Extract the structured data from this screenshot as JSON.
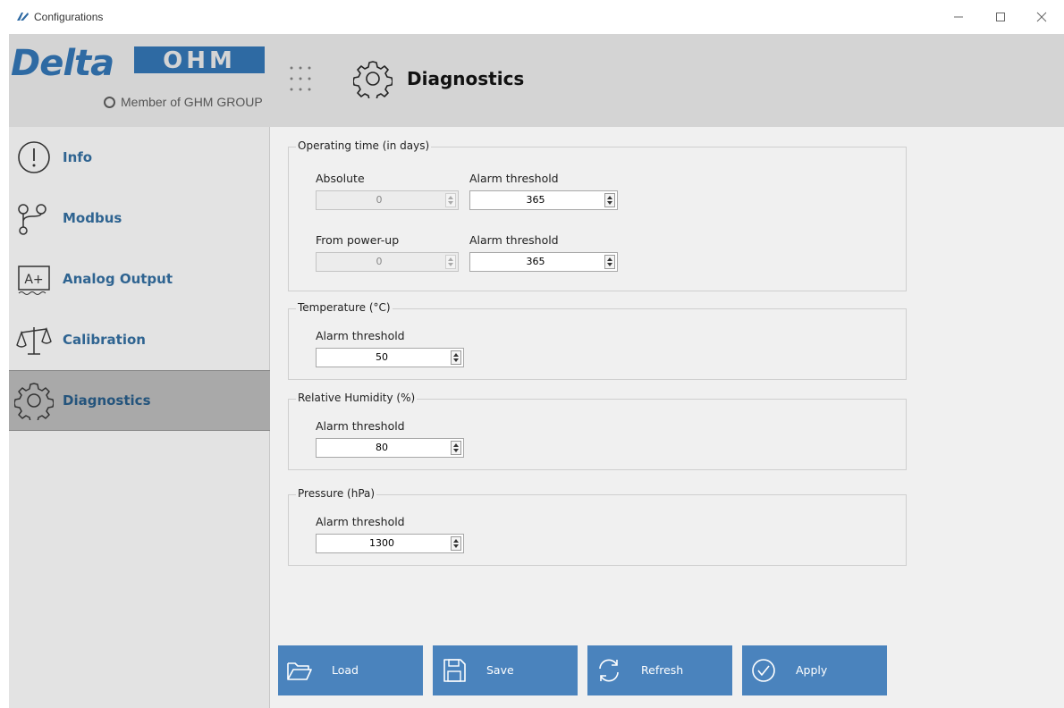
{
  "window": {
    "title": "Configurations"
  },
  "logo": {
    "wordmark": "DeltaOHM",
    "tagline": "Member of GHM GROUP"
  },
  "header": {
    "title": "Diagnostics"
  },
  "sidebar": {
    "items": [
      {
        "label": "Info",
        "icon": "info-icon"
      },
      {
        "label": "Modbus",
        "icon": "modbus-icon"
      },
      {
        "label": "Analog Output",
        "icon": "analog-output-icon"
      },
      {
        "label": "Calibration",
        "icon": "balance-scale-icon"
      },
      {
        "label": "Diagnostics",
        "icon": "gear-icon",
        "active": true
      }
    ]
  },
  "groups": {
    "operating": {
      "title": "Operating time (in days)",
      "absolute_label": "Absolute",
      "absolute_value": "0",
      "absolute_threshold_label": "Alarm threshold",
      "absolute_threshold_value": "365",
      "powerup_label": "From power-up",
      "powerup_value": "0",
      "powerup_threshold_label": "Alarm threshold",
      "powerup_threshold_value": "365"
    },
    "temperature": {
      "title": "Temperature (°C)",
      "threshold_label": "Alarm threshold",
      "threshold_value": "50"
    },
    "humidity": {
      "title": "Relative Humidity (%)",
      "threshold_label": "Alarm threshold",
      "threshold_value": "80"
    },
    "pressure": {
      "title": "Pressure (hPa)",
      "threshold_label": "Alarm threshold",
      "threshold_value": "1300"
    }
  },
  "buttons": {
    "load": "Load",
    "save": "Save",
    "refresh": "Refresh",
    "apply": "Apply"
  },
  "colors": {
    "accent": "#4a83bd",
    "nav_text": "#2f6491",
    "logo_blue": "#2e6aa3",
    "active_item": "#a9a9a9"
  }
}
